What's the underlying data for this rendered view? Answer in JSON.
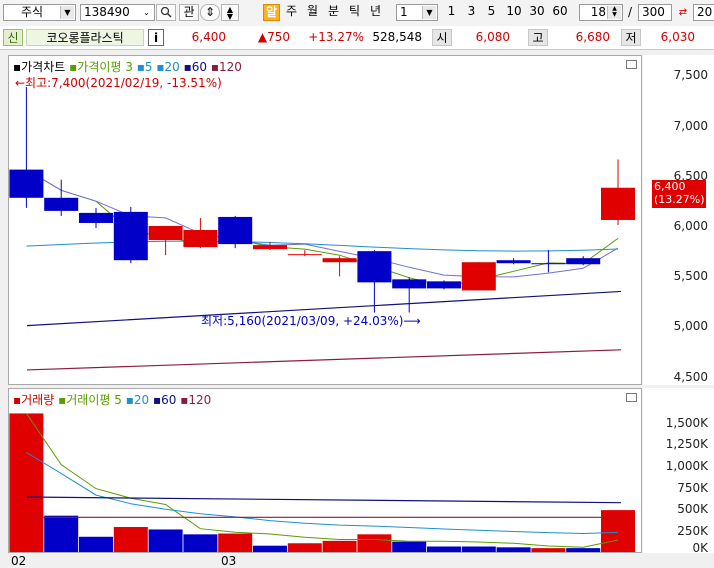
{
  "toolbar": {
    "market_select": "주식",
    "code_input": "138490",
    "search_icon": "search-icon",
    "btn_gwan": "관",
    "btn_sort": "⇕",
    "btn_al": "알",
    "period_day": "주",
    "period_week": "월",
    "period_min": "분",
    "period_tick": "틱",
    "period_year": "년",
    "interval_value": "1",
    "btn_1": "1",
    "btn_3": "3",
    "btn_5": "5",
    "btn_10": "10",
    "btn_30": "30",
    "btn_60": "60",
    "count_value": "18",
    "slash": "/",
    "total_value": "300",
    "right_trunc": "20"
  },
  "infobar": {
    "tag": "신",
    "name": "코오롱플라스틱",
    "info_btn": "i",
    "price": "6,400",
    "change": "▲750",
    "rate": "+13.27%",
    "volume": "528,548",
    "open_label": "시",
    "open_value": "6,080",
    "high_label": "고",
    "high_value": "6,680",
    "low_label": "저",
    "low_value": "6,030"
  },
  "price_chart": {
    "legend_title": "가격차트",
    "legend_disparity": "가격이평 3",
    "ma5": "5",
    "ma20": "20",
    "ma60": "60",
    "ma120": "120",
    "max_note": "←최고:7,400(2021/02/19, -13.51%)",
    "min_note": "최저:5,160(2021/03/09, +24.03%)⟶",
    "current_label_price": "6,400",
    "current_label_rate": "(13.27%)",
    "y_ticks": [
      "7,500",
      "7,000",
      "6,500",
      "6,000",
      "5,500",
      "5,000",
      "4,500"
    ]
  },
  "volume_chart": {
    "legend_title": "거래량",
    "legend_disparity": "거래이평 5",
    "ma20": "20",
    "ma60": "60",
    "ma120": "120",
    "y_ticks": [
      "1,500K",
      "1,250K",
      "1,000K",
      "750K",
      "500K",
      "250K",
      "0K"
    ]
  },
  "x_axis": {
    "label_feb": "02",
    "label_mar": "03"
  },
  "chart_data": {
    "type": "candlestick",
    "candles": [
      {
        "open": 6300,
        "high": 7400,
        "low": 6200,
        "close": 6580,
        "color": "down"
      },
      {
        "open": 6300,
        "high": 6480,
        "low": 6120,
        "close": 6170,
        "color": "down"
      },
      {
        "open": 6150,
        "high": 6200,
        "low": 6000,
        "close": 6050,
        "color": "down"
      },
      {
        "open": 6160,
        "high": 6210,
        "low": 5650,
        "close": 5680,
        "color": "down"
      },
      {
        "open": 5880,
        "high": 6020,
        "low": 5730,
        "close": 6020,
        "color": "up"
      },
      {
        "open": 5980,
        "high": 6100,
        "low": 5800,
        "close": 5810,
        "color": "up"
      },
      {
        "open": 6110,
        "high": 6120,
        "low": 5800,
        "close": 5840,
        "color": "down"
      },
      {
        "open": 5830,
        "high": 5860,
        "low": 5780,
        "close": 5790,
        "color": "up"
      },
      {
        "open": 5740,
        "high": 5780,
        "low": 5720,
        "close": 5740,
        "color": "up"
      },
      {
        "open": 5700,
        "high": 5720,
        "low": 5520,
        "close": 5660,
        "color": "up"
      },
      {
        "open": 5770,
        "high": 5780,
        "low": 5160,
        "close": 5460,
        "color": "down"
      },
      {
        "open": 5490,
        "high": 5510,
        "low": 5160,
        "close": 5400,
        "color": "down"
      },
      {
        "open": 5470,
        "high": 5480,
        "low": 5390,
        "close": 5400,
        "color": "down"
      },
      {
        "open": 5380,
        "high": 5660,
        "low": 5380,
        "close": 5660,
        "color": "up"
      },
      {
        "open": 5680,
        "high": 5700,
        "low": 5640,
        "close": 5650,
        "color": "down"
      },
      {
        "open": 5650,
        "high": 5780,
        "low": 5560,
        "close": 5650,
        "color": "down"
      },
      {
        "open": 5700,
        "high": 5720,
        "low": 5630,
        "close": 5640,
        "color": "down"
      },
      {
        "open": 6080,
        "high": 6680,
        "low": 6030,
        "close": 6400,
        "color": "up"
      }
    ],
    "volumes": [
      {
        "value": 1720000,
        "color": "up"
      },
      {
        "value": 460000,
        "color": "down"
      },
      {
        "value": 200000,
        "color": "down"
      },
      {
        "value": 320000,
        "color": "up"
      },
      {
        "value": 290000,
        "color": "down"
      },
      {
        "value": 230000,
        "color": "down"
      },
      {
        "value": 240000,
        "color": "up"
      },
      {
        "value": 90000,
        "color": "down"
      },
      {
        "value": 120000,
        "color": "up"
      },
      {
        "value": 150000,
        "color": "up"
      },
      {
        "value": 230000,
        "color": "up"
      },
      {
        "value": 140000,
        "color": "down"
      },
      {
        "value": 80000,
        "color": "down"
      },
      {
        "value": 80000,
        "color": "down"
      },
      {
        "value": 70000,
        "color": "down"
      },
      {
        "value": 60000,
        "color": "up"
      },
      {
        "value": 60000,
        "color": "down"
      },
      {
        "value": 528548,
        "color": "up"
      }
    ],
    "price_range": [
      4500,
      7500
    ],
    "volume_range": [
      0,
      1750000
    ],
    "colors": {
      "up": "#e00000",
      "down": "#0000c8",
      "ma5": "#5a9c00",
      "ma20": "#1f8fd0",
      "ma60": "#101080",
      "ma120": "#8c1c3c"
    }
  }
}
